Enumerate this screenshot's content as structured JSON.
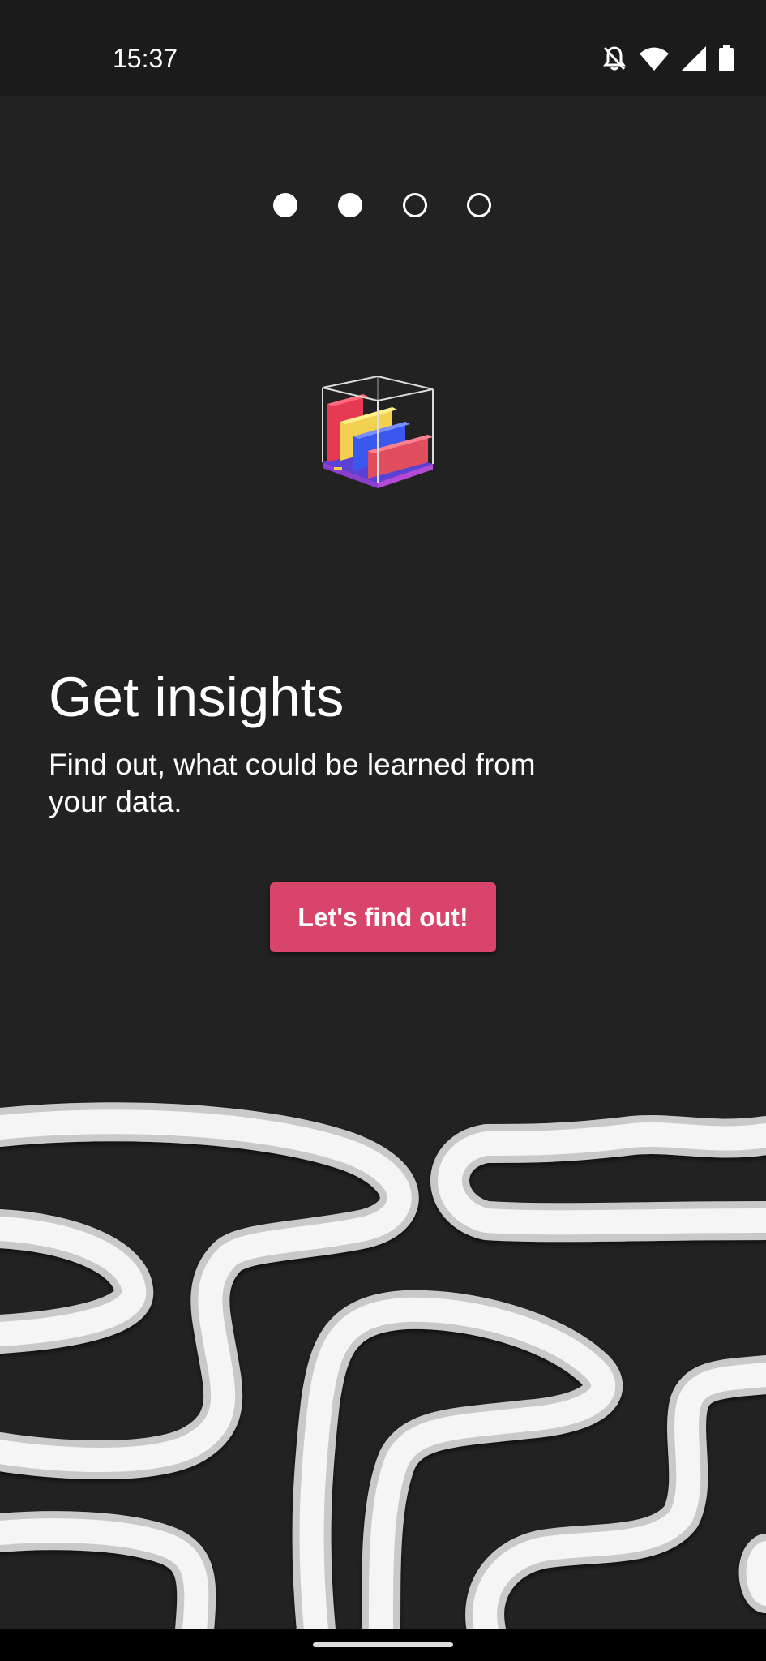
{
  "status_bar": {
    "time": "15:37",
    "icons": [
      "notifications-off-icon",
      "wifi-icon",
      "cellular-signal-icon",
      "battery-icon"
    ]
  },
  "pager": {
    "total": 4,
    "filled": 2
  },
  "onboarding": {
    "title": "Get insights",
    "subtitle": "Find out, what could be learned from your data.",
    "button_label": "Let's find out!",
    "illustration_icon": "3d-bar-chart-cube-icon"
  },
  "colors": {
    "background": "#222222",
    "status_bar": "#1b1b1b",
    "accent": "#d9456a",
    "text": "#ffffff"
  },
  "nav_bar": {
    "handle_icon": "gesture-handle"
  }
}
